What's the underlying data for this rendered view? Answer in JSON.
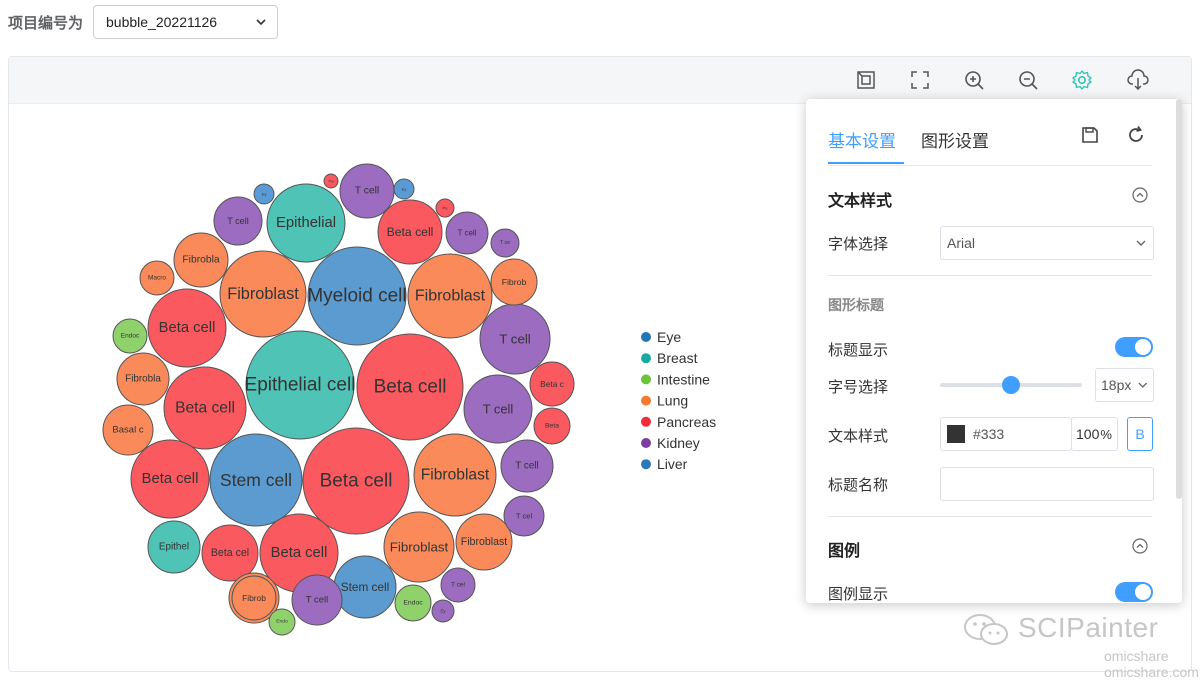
{
  "header": {
    "project_label": "项目编号为",
    "project_value": "bubble_20221126"
  },
  "toolbar": {
    "icons": [
      "restore-icon",
      "fullscreen-icon",
      "zoom-in-icon",
      "zoom-out-icon",
      "settings-icon",
      "download-icon"
    ],
    "active_color": "#2fc6b5",
    "icon_color": "#555555"
  },
  "chart_data": {
    "type": "bubble",
    "legend_position": "right",
    "legend": [
      {
        "name": "Eye",
        "color": "#1f77b4"
      },
      {
        "name": "Breast",
        "color": "#17a9a0"
      },
      {
        "name": "Intestine",
        "color": "#6ac43c"
      },
      {
        "name": "Lung",
        "color": "#f47a30"
      },
      {
        "name": "Pancreas",
        "color": "#ef2d37"
      },
      {
        "name": "Kidney",
        "color": "#7b3ea0"
      },
      {
        "name": "Liver",
        "color": "#2c78b8"
      }
    ],
    "bubbles": [
      {
        "label": "Epithelial cell",
        "group": "Breast",
        "size": 54
      },
      {
        "label": "Beta cell",
        "group": "Pancreas",
        "size": 53
      },
      {
        "label": "Beta cell",
        "group": "Pancreas",
        "size": 53
      },
      {
        "label": "Myeloid cell",
        "group": "Liver",
        "size": 49
      },
      {
        "label": "Stem cell",
        "group": "Liver",
        "size": 46
      },
      {
        "label": "Fibroblast",
        "group": "Lung",
        "size": 43
      },
      {
        "label": "Fibroblast",
        "group": "Lung",
        "size": 42
      },
      {
        "label": "Fibroblast",
        "group": "Lung",
        "size": 41
      },
      {
        "label": "Beta cell",
        "group": "Pancreas",
        "size": 41
      },
      {
        "label": "Beta cell",
        "group": "Pancreas",
        "size": 39
      },
      {
        "label": "Beta cell",
        "group": "Pancreas",
        "size": 39
      },
      {
        "label": "Beta cell",
        "group": "Pancreas",
        "size": 39
      },
      {
        "label": "Epithelial",
        "group": "Breast",
        "size": 39
      },
      {
        "label": "T cell",
        "group": "Kidney",
        "size": 35
      },
      {
        "label": "Fibroblast",
        "group": "Lung",
        "size": 35
      },
      {
        "label": "T cell",
        "group": "Kidney",
        "size": 34
      },
      {
        "label": "Stem cell",
        "group": "Liver",
        "size": 31
      },
      {
        "label": "Beta cell",
        "group": "Pancreas",
        "size": 32
      },
      {
        "label": "Fibroblast",
        "group": "Lung",
        "size": 28
      },
      {
        "label": "Beta cel",
        "group": "Pancreas",
        "size": 28
      },
      {
        "label": "Fibrobla",
        "group": "Lung",
        "size": 27
      },
      {
        "label": "T cell",
        "group": "Kidney",
        "size": 27
      },
      {
        "label": "Basal c",
        "group": "Lung",
        "size": 25
      },
      {
        "label": "Fibrobla",
        "group": "Lung",
        "size": 26
      },
      {
        "label": "T cell",
        "group": "Kidney",
        "size": 26
      },
      {
        "label": "Epithel",
        "group": "Breast",
        "size": 26
      },
      {
        "label": "T cell",
        "group": "Kidney",
        "size": 24
      },
      {
        "label": "T cell",
        "group": "Kidney",
        "size": 25
      },
      {
        "label": "Fibrobla",
        "group": "Lung",
        "size": 25
      },
      {
        "label": "T cell",
        "group": "Kidney",
        "size": 21
      },
      {
        "label": "Fibrob",
        "group": "Lung",
        "size": 23
      },
      {
        "label": "Beta c",
        "group": "Pancreas",
        "size": 22
      },
      {
        "label": "T cel",
        "group": "Kidney",
        "size": 20
      },
      {
        "label": "Fibrob",
        "group": "Lung",
        "size": 22
      },
      {
        "label": "Endoc",
        "group": "Intestine",
        "size": 18
      },
      {
        "label": "Beta",
        "group": "Pancreas",
        "size": 18
      },
      {
        "label": "Macro",
        "group": "Lung",
        "size": 17
      },
      {
        "label": "T cel",
        "group": "Kidney",
        "size": 17
      },
      {
        "label": "Endoc",
        "group": "Intestine",
        "size": 17
      },
      {
        "label": "T ce",
        "group": "Kidney",
        "size": 14
      },
      {
        "label": "Endo",
        "group": "Intestine",
        "size": 13
      },
      {
        "label": "Ey",
        "group": "Kidney",
        "size": 11
      },
      {
        "label": "Ey",
        "group": "Eye",
        "size": 10
      },
      {
        "label": "Ey",
        "group": "Eye",
        "size": 10
      },
      {
        "label": "Pa",
        "group": "Pancreas",
        "size": 9
      },
      {
        "label": "Pa",
        "group": "Pancreas",
        "size": 7
      }
    ]
  },
  "settings": {
    "tab_basic": "基本设置",
    "tab_graph": "图形设置",
    "text_style_section": "文本样式",
    "font_label": "字体选择",
    "font_value": "Arial",
    "graph_title_sub": "图形标题",
    "title_show_label": "标题显示",
    "title_show": true,
    "font_size_label": "字号选择",
    "font_size_fraction": 0.5,
    "font_size_value": "18px",
    "text_style_label": "文本样式",
    "color_value": "#333",
    "opacity_value": "100",
    "opacity_unit": "%",
    "bold_label": "B",
    "title_name_label": "标题名称",
    "title_name_value": "",
    "legend_section": "图例",
    "legend_show_label": "图例显示",
    "legend_show": true
  },
  "watermark": {
    "brand": "SCIPainter",
    "site1": "omicshare",
    "site2": "omicshare.com"
  }
}
